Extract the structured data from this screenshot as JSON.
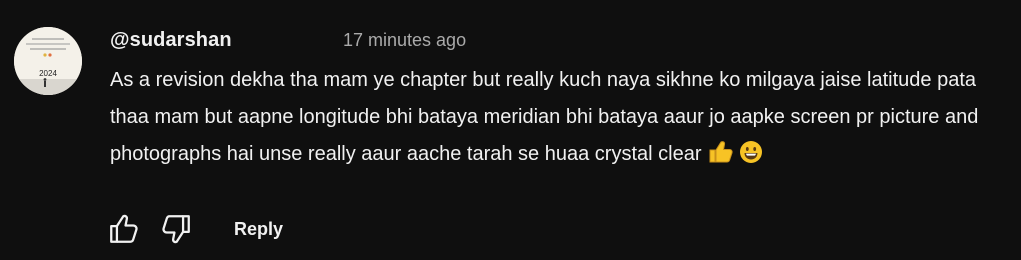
{
  "comment": {
    "author": "@sudarshan",
    "timestamp": "17 minutes ago",
    "text": "As a revision dekha tha mam ye chapter but really kuch naya sikhne ko milgaya jaise latitude pata thaa mam but aapne longitude bhi bataya meridian bhi bataya aaur jo aapke screen pr picture and photographs hai unse really aaur aache tarah se huaa crystal clear",
    "emojis": [
      "thumbs-up-emoji",
      "grinning-face-emoji"
    ],
    "avatar_caption": "2024"
  },
  "actions": {
    "like_icon": "thumbs-up-outline-icon",
    "dislike_icon": "thumbs-down-outline-icon",
    "reply_label": "Reply"
  },
  "colors": {
    "background": "#0f0f0f",
    "text_primary": "#f1f1f1",
    "text_secondary": "#aaaaaa",
    "emoji_yellow": "#f7c325"
  }
}
